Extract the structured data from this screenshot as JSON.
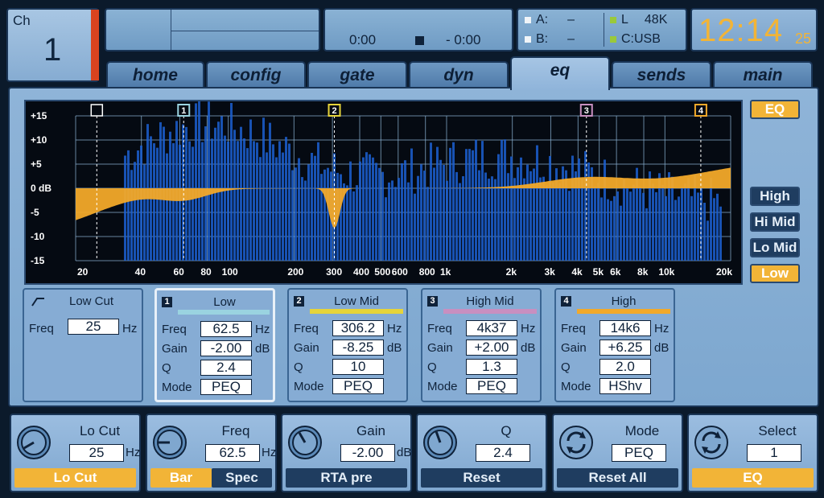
{
  "header": {
    "channel_label": "Ch",
    "channel_number": "1",
    "time_elapsed": "0:00",
    "time_remaining": "- 0:00",
    "slot_a_label": "A:",
    "slot_a_value": "–",
    "slot_b_label": "B:",
    "slot_b_value": "–",
    "output_label": "L",
    "sample_rate": "48K",
    "source": "C:USB",
    "clock_hm": "12:14",
    "clock_sec": "25"
  },
  "tabs": [
    {
      "label": "home"
    },
    {
      "label": "config"
    },
    {
      "label": "gate"
    },
    {
      "label": "dyn"
    },
    {
      "label": "eq"
    },
    {
      "label": "sends"
    },
    {
      "label": "main"
    }
  ],
  "graph": {
    "y_labels": [
      "+15",
      "+10",
      "+5",
      "0 dB",
      "-5",
      "-10",
      "-15"
    ],
    "x_labels": [
      "20",
      "40",
      "60",
      "80",
      "100",
      "200",
      "300",
      "400",
      "500",
      "600",
      "800",
      "1k",
      "2k",
      "3k",
      "4k",
      "5k",
      "6k",
      "8k",
      "10k",
      "20k"
    ],
    "markers": [
      "1",
      "2",
      "3",
      "4"
    ],
    "colors": {
      "curve": "#f2a92a",
      "rta": "#1c5fd0",
      "band1": "#9ad3e0",
      "band2": "#e6d43a",
      "band3": "#c88fc0",
      "band4": "#f2a92a"
    }
  },
  "side_buttons": {
    "eq": "EQ",
    "high": "High",
    "hi_mid": "Hi Mid",
    "lo_mid": "Lo Mid",
    "low": "Low"
  },
  "low_cut": {
    "title": "Low Cut",
    "freq_label": "Freq",
    "freq_value": "25",
    "freq_unit": "Hz"
  },
  "bands": [
    {
      "num": "1",
      "name": "Low",
      "freq": "62.5",
      "gain": "-2.00",
      "q": "2.4",
      "mode": "PEQ"
    },
    {
      "num": "2",
      "name": "Low Mid",
      "freq": "306.2",
      "gain": "-8.25",
      "q": "10",
      "mode": "PEQ"
    },
    {
      "num": "3",
      "name": "High Mid",
      "freq": "4k37",
      "gain": "+2.00",
      "q": "1.3",
      "mode": "PEQ"
    },
    {
      "num": "4",
      "name": "High",
      "freq": "14k6",
      "gain": "+6.25",
      "q": "2.0",
      "mode": "HShv"
    }
  ],
  "band_labels": {
    "freq": "Freq",
    "gain": "Gain",
    "q": "Q",
    "mode": "Mode",
    "hz": "Hz",
    "db": "dB"
  },
  "knobs": [
    {
      "title": "Lo Cut",
      "value": "25",
      "unit": "Hz",
      "btn": "Lo Cut"
    },
    {
      "title": "Freq",
      "value": "62.5",
      "unit": "Hz",
      "btn_a": "Bar",
      "btn_b": "Spec"
    },
    {
      "title": "Gain",
      "value": "-2.00",
      "unit": "dB",
      "btn": "RTA pre"
    },
    {
      "title": "Q",
      "value": "2.4",
      "unit": "",
      "btn": "Reset"
    },
    {
      "title": "Mode",
      "value": "PEQ",
      "unit": "",
      "btn": "Reset All"
    },
    {
      "title": "Select",
      "value": "1",
      "unit": "",
      "btn": "EQ"
    }
  ]
}
